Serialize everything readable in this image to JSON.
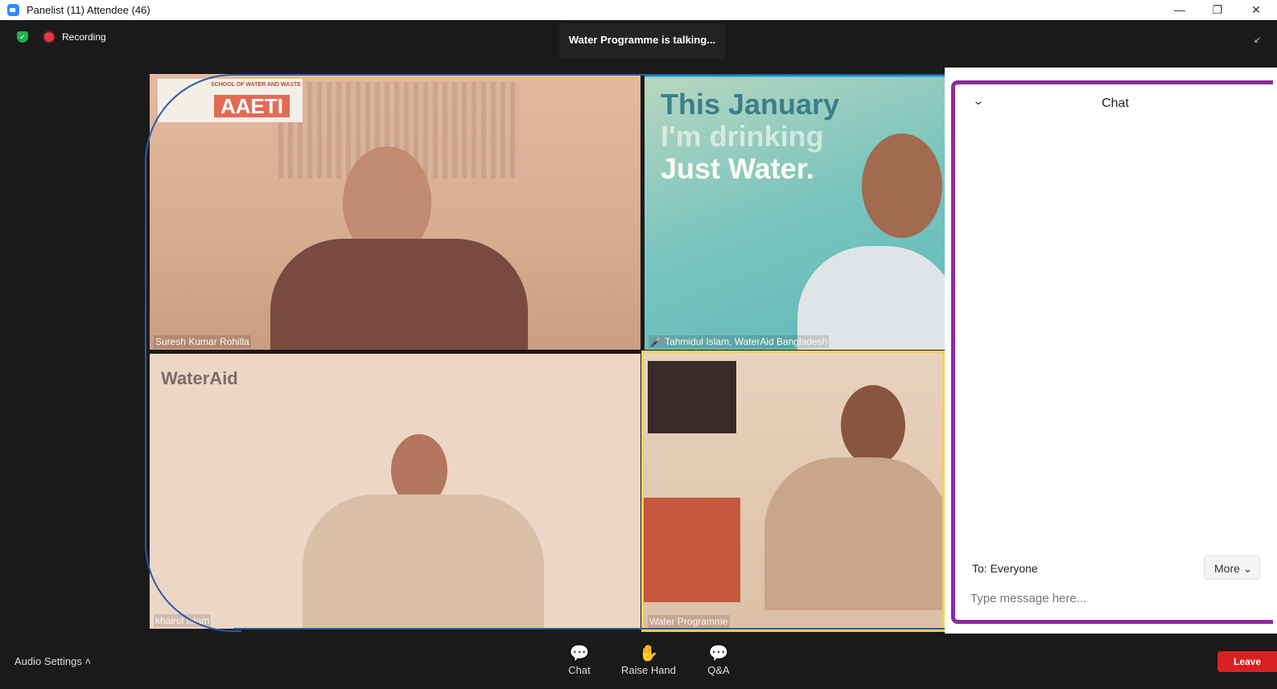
{
  "window": {
    "title": "Panelist (11) Attendee (46)",
    "minimize": "—",
    "restore": "❐",
    "close": "✕"
  },
  "status": {
    "recording_label": "Recording",
    "talking": "Water Programme is talking..."
  },
  "videos": [
    {
      "name": "Suresh Kumar Rohilla",
      "logo_text": "AAETI",
      "logo_sub": "SCHOOL OF WATER AND WASTE"
    },
    {
      "name": "Tahmidul Islam, WaterAid Bangladesh",
      "poster_line1": "This January",
      "poster_line2": "I'm drinking",
      "poster_line3": "Just Water."
    },
    {
      "name": "khairul Islam",
      "logo_text": "WaterAid"
    },
    {
      "name": "Water Programme"
    }
  ],
  "chat": {
    "title": "Chat",
    "to_label": "To: Everyone",
    "more_label": "More ⌄",
    "input_placeholder": "Type message here..."
  },
  "toolbar": {
    "audio_settings": "Audio Settings ˄",
    "chat": "Chat",
    "raise_hand": "Raise Hand",
    "qa": "Q&A",
    "leave": "Leave"
  },
  "colors": {
    "chat_border": "#8f2a9e",
    "leave_button": "#d92121",
    "active_speaker": "#f2d15c"
  }
}
